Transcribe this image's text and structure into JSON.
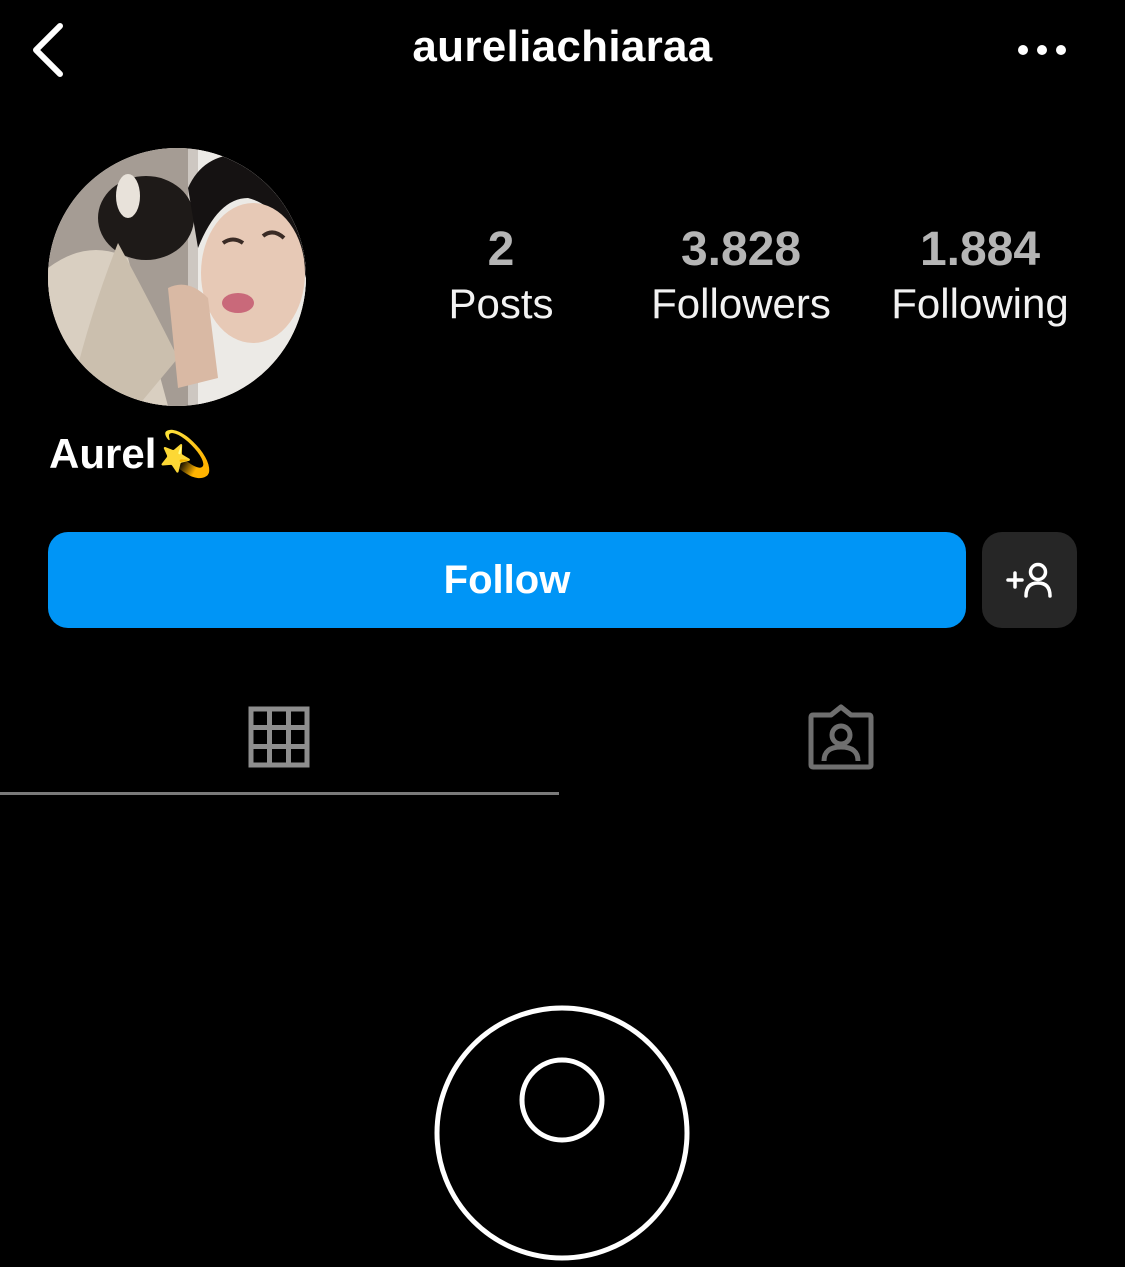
{
  "header": {
    "back_icon": "chevron-left-icon",
    "username": "aureliachiaraa",
    "more_icon": "more-horizontal-icon"
  },
  "profile": {
    "display_name": "Aurel",
    "display_name_emoji": "💫",
    "stats": [
      {
        "value": "2",
        "label": "Posts"
      },
      {
        "value": "3.828",
        "label": "Followers"
      },
      {
        "value": "1.884",
        "label": "Following"
      }
    ]
  },
  "actions": {
    "follow_label": "Follow",
    "follow_color": "#0095f6",
    "suggest_icon": "add-person-icon"
  },
  "tabs": [
    {
      "icon": "grid-icon",
      "active": true
    },
    {
      "icon": "tagged-user-icon",
      "active": false
    }
  ],
  "empty_state": {
    "icon": "camera-icon"
  }
}
